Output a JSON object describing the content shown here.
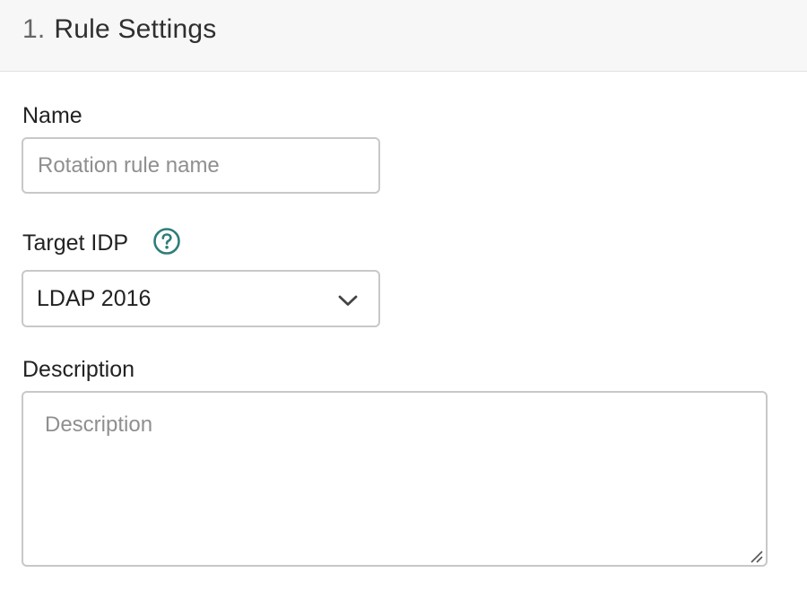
{
  "section": {
    "number": "1.",
    "title": "Rule Settings"
  },
  "name_field": {
    "label": "Name",
    "placeholder": "Rotation rule name",
    "value": ""
  },
  "target_idp": {
    "label": "Target IDP",
    "help_icon": "question-circle-icon",
    "selected": "LDAP 2016",
    "dropdown_icon": "chevron-down-icon"
  },
  "description_field": {
    "label": "Description",
    "placeholder": "Description",
    "value": ""
  },
  "colors": {
    "accent": "#2e7d7a",
    "border": "#c8c8c8",
    "header_bg": "#f7f7f7"
  }
}
